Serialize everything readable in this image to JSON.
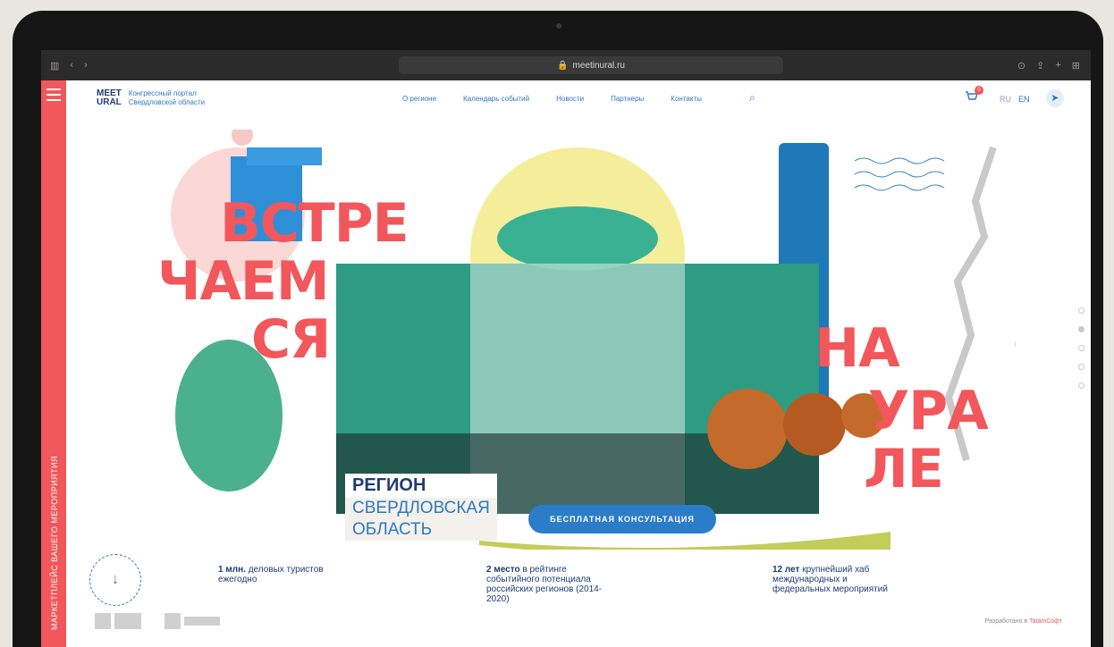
{
  "browser": {
    "url": "meetinural.ru"
  },
  "header": {
    "logo_line1": "MEET",
    "logo_line2": "URAL",
    "logo_subtitle_1": "Конгрессный портал",
    "logo_subtitle_2": "Свердловской области",
    "nav": [
      "О регионе",
      "Календарь событий",
      "Новости",
      "Партнеры",
      "Контакты"
    ],
    "cart_count": "0",
    "lang_ru": "RU",
    "lang_en": "EN"
  },
  "side_rail": {
    "text": "МАРКЕТПЛЕЙС ВАШЕГО МЕРОПРИЯТИЯ"
  },
  "hero": {
    "word_1": "ВСТРЕ",
    "word_2": "ЧАЕМ",
    "word_3": "СЯ",
    "word_4": "НА",
    "word_5": "УРА",
    "word_6": "ЛЕ",
    "region_title": "РЕГИОН",
    "region_line_1": "СВЕРДЛОВСКАЯ",
    "region_line_2": "ОБЛАСТЬ",
    "cta": "БЕСПЛАТНАЯ КОНСУЛЬТАЦИЯ"
  },
  "stats": [
    {
      "bold": "1 млн.",
      "text": " деловых туристов ежегодно"
    },
    {
      "bold": "2 место",
      "text": " в рейтинге событийного потенциала российских регионов (2014-2020)"
    },
    {
      "bold": "12 лет",
      "text": " крупнейший хаб международных и федеральных мероприятий"
    }
  ],
  "footer": {
    "developed_by": "Разработано в",
    "developer": "TatamСофт"
  },
  "colors": {
    "accent": "#f2575b",
    "brand_blue": "#2b79c2",
    "dark_blue": "#1f3b74"
  }
}
